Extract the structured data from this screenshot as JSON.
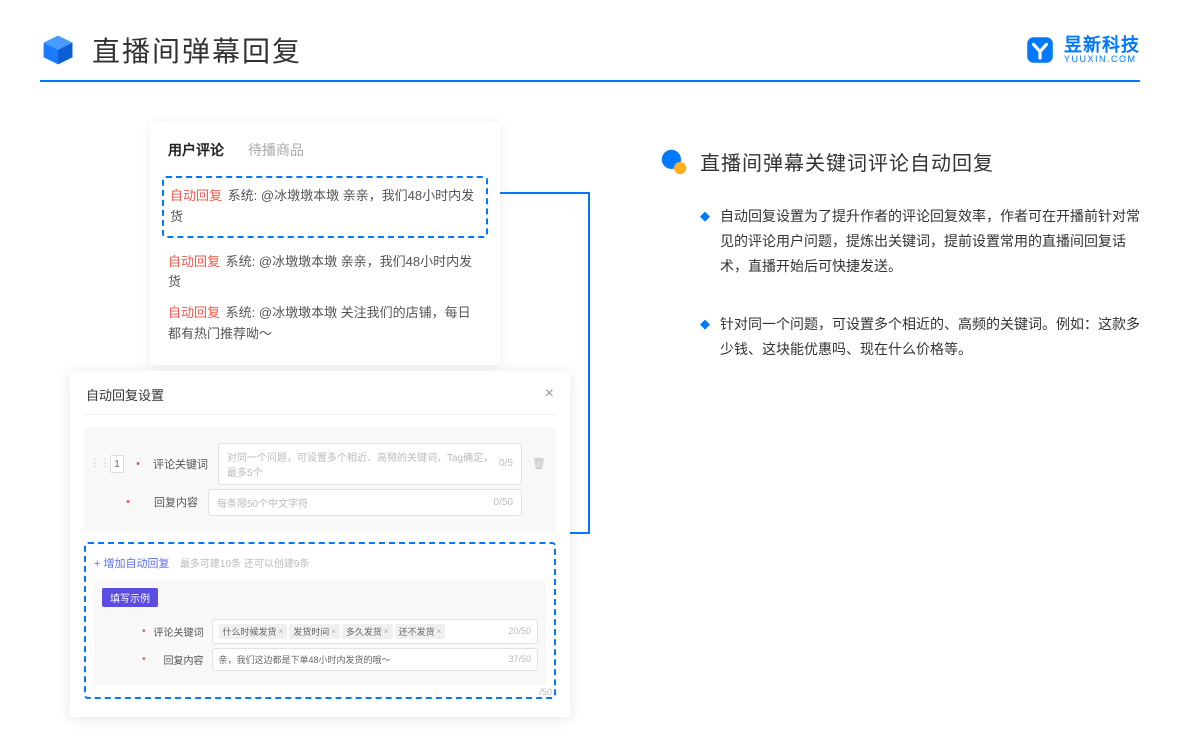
{
  "header": {
    "title": "直播间弹幕回复",
    "brand_name": "昱新科技",
    "brand_sub": "YUUXIN.COM"
  },
  "comments": {
    "tab_active": "用户评论",
    "tab_inactive": "待播商品",
    "auto_badge": "自动回复",
    "row1_prefix": "系统: ",
    "row1_text": "@冰墩墩本墩 亲亲，我们48小时内发货",
    "row2_prefix": "系统: ",
    "row2_text": "@冰墩墩本墩 亲亲，我们48小时内发货",
    "row3_prefix": "系统: ",
    "row3_text": "@冰墩墩本墩 关注我们的店铺，每日都有热门推荐呦～"
  },
  "settings": {
    "title": "自动回复设置",
    "row_num": "1",
    "field_keyword": "评论关键词",
    "keyword_placeholder": "对同一个问题，可设置多个相近、高频的关键词，Tag确定，最多5个",
    "keyword_counter": "0/5",
    "field_content": "回复内容",
    "content_placeholder": "每条限50个中文字符",
    "content_counter": "0/50",
    "add_link": "+ 增加自动回复",
    "add_hint": "最多可建10条 还可以创建9条",
    "example_pill": "填写示例",
    "ex_keyword_label": "评论关键词",
    "ex_tags": [
      "什么时候发货",
      "发货时间",
      "多久发货",
      "还不发货"
    ],
    "ex_keyword_counter": "20/50",
    "ex_content_label": "回复内容",
    "ex_content_value": "亲，我们这边都是下单48小时内发货的哦～",
    "ex_content_counter": "37/50",
    "outer_counter": "/50"
  },
  "right": {
    "section_title": "直播间弹幕关键词评论自动回复",
    "bullets": [
      "自动回复设置为了提升作者的评论回复效率，作者可在开播前针对常见的评论用户问题，提炼出关键词，提前设置常用的直播间回复话术，直播开始后可快捷发送。",
      "针对同一个问题，可设置多个相近的、高频的关键词。例如：这款多少钱、这块能优惠吗、现在什么价格等。"
    ]
  }
}
